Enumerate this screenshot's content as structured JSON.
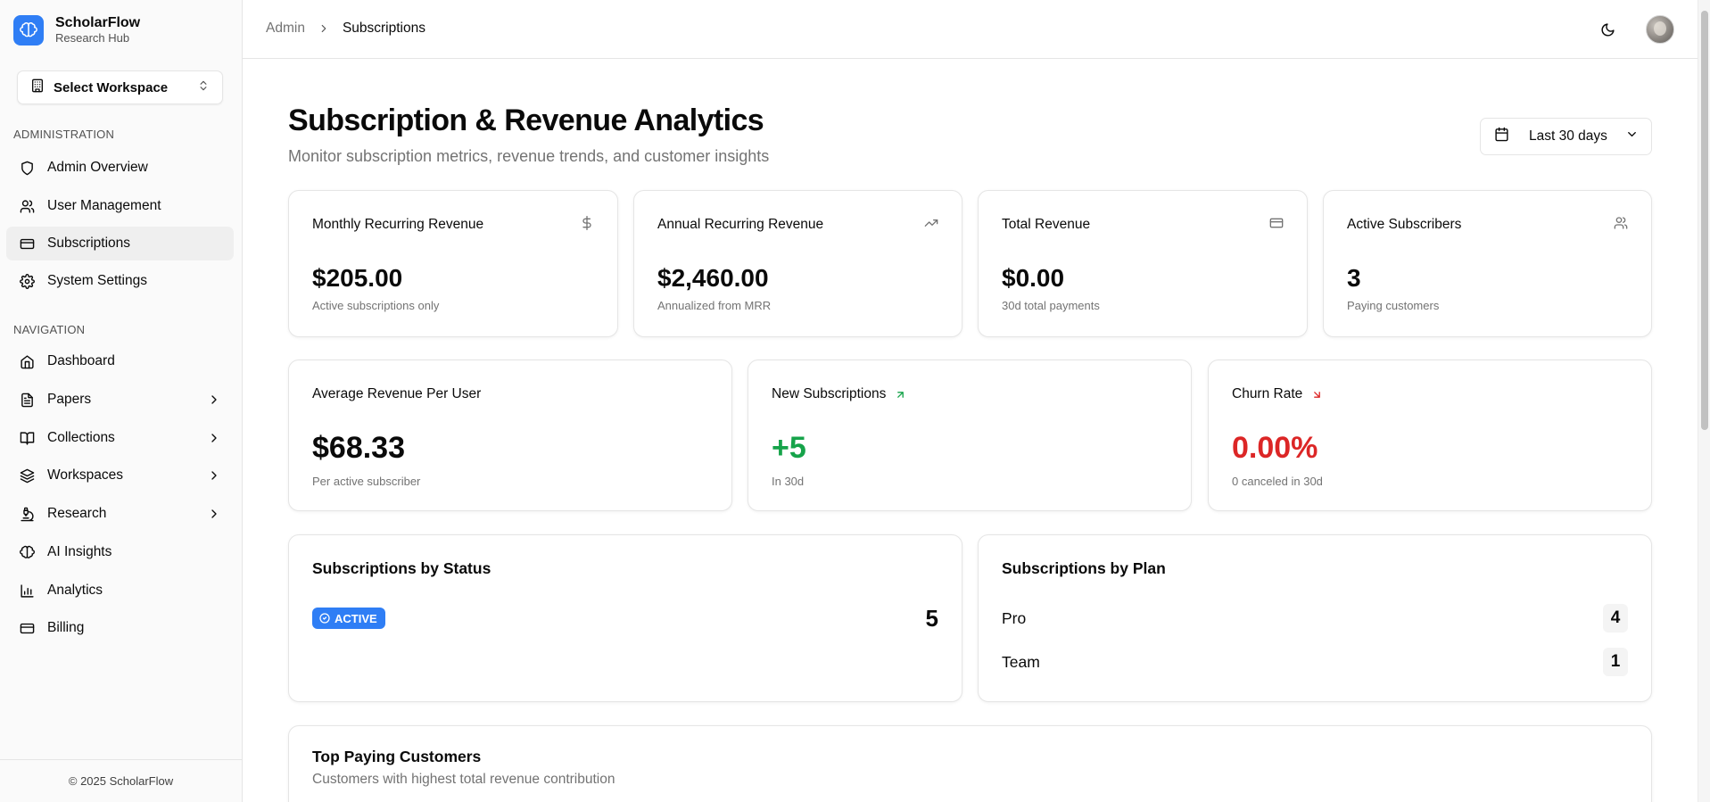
{
  "brand": {
    "title": "ScholarFlow",
    "subtitle": "Research Hub"
  },
  "workspace_select": {
    "label": "Select Workspace"
  },
  "sidebar": {
    "admin_section": "ADMINISTRATION",
    "admin_items": [
      {
        "label": "Admin Overview",
        "icon": "shield-icon"
      },
      {
        "label": "User Management",
        "icon": "users-icon"
      },
      {
        "label": "Subscriptions",
        "icon": "credit-card-icon",
        "active": true
      },
      {
        "label": "System Settings",
        "icon": "gear-icon"
      }
    ],
    "nav_section": "NAVIGATION",
    "nav_items": [
      {
        "label": "Dashboard",
        "icon": "home-icon"
      },
      {
        "label": "Papers",
        "icon": "file-text-icon",
        "expandable": true
      },
      {
        "label": "Collections",
        "icon": "book-open-icon",
        "expandable": true
      },
      {
        "label": "Workspaces",
        "icon": "layers-icon",
        "expandable": true
      },
      {
        "label": "Research",
        "icon": "microscope-icon",
        "expandable": true
      },
      {
        "label": "AI Insights",
        "icon": "brain-icon"
      },
      {
        "label": "Analytics",
        "icon": "bar-chart-icon"
      },
      {
        "label": "Billing",
        "icon": "credit-card-icon"
      }
    ],
    "footer": "© 2025 ScholarFlow"
  },
  "header": {
    "breadcrumb": [
      "Admin",
      "Subscriptions"
    ]
  },
  "page": {
    "title": "Subscription & Revenue Analytics",
    "subtitle": "Monitor subscription metrics, revenue trends, and customer insights",
    "date_range": "Last 30 days"
  },
  "metrics_row1": [
    {
      "title": "Monthly Recurring Revenue",
      "value": "$205.00",
      "note": "Active subscriptions only",
      "icon": "dollar-icon"
    },
    {
      "title": "Annual Recurring Revenue",
      "value": "$2,460.00",
      "note": "Annualized from MRR",
      "icon": "trending-up-icon"
    },
    {
      "title": "Total Revenue",
      "value": "$0.00",
      "note": "30d total payments",
      "icon": "credit-card-icon"
    },
    {
      "title": "Active Subscribers",
      "value": "3",
      "note": "Paying customers",
      "icon": "users-icon"
    }
  ],
  "metrics_row2": [
    {
      "title": "Average Revenue Per User",
      "value": "$68.33",
      "note": "Per active subscriber"
    },
    {
      "title": "New Subscriptions",
      "value": "+5",
      "note": "In 30d",
      "icon": "arrow-up-right-icon",
      "color": "#16a34a"
    },
    {
      "title": "Churn Rate",
      "value": "0.00%",
      "note": "0 canceled in 30d",
      "icon": "arrow-down-right-icon",
      "color": "#dc2626"
    }
  ],
  "status_card": {
    "title": "Subscriptions by Status",
    "badge": "ACTIVE",
    "count": "5"
  },
  "plan_card": {
    "title": "Subscriptions by Plan",
    "plans": [
      {
        "name": "Pro",
        "count": "4"
      },
      {
        "name": "Team",
        "count": "1"
      }
    ]
  },
  "top_customers": {
    "title": "Top Paying Customers",
    "subtitle": "Customers with highest total revenue contribution"
  },
  "colors": {
    "accent": "#2f7ef5",
    "positive": "#16a34a",
    "negative": "#dc2626"
  }
}
